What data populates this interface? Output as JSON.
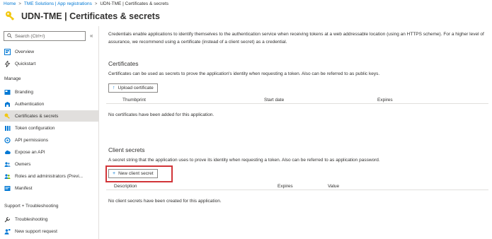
{
  "breadcrumb": {
    "items": [
      "Home",
      "TME Solutions | App registrations",
      "UDN-TME | Certificates & secrets"
    ],
    "separator": ">"
  },
  "header": {
    "title": "UDN-TME | Certificates & secrets",
    "icon": "key-icon"
  },
  "sidebar": {
    "search_placeholder": "Search (Ctrl+/)",
    "collapse_label": "«",
    "top_items": [
      {
        "label": "Overview",
        "icon": "overview-icon"
      },
      {
        "label": "Quickstart",
        "icon": "quickstart-icon"
      }
    ],
    "manage_heading": "Manage",
    "manage_items": [
      {
        "label": "Branding",
        "icon": "branding-icon"
      },
      {
        "label": "Authentication",
        "icon": "authentication-icon"
      },
      {
        "label": "Certificates & secrets",
        "icon": "key-icon",
        "active": true
      },
      {
        "label": "Token configuration",
        "icon": "token-icon"
      },
      {
        "label": "API permissions",
        "icon": "api-permissions-icon"
      },
      {
        "label": "Expose an API",
        "icon": "cloud-icon"
      },
      {
        "label": "Owners",
        "icon": "owners-icon"
      },
      {
        "label": "Roles and administrators (Previ...",
        "icon": "roles-icon"
      },
      {
        "label": "Manifest",
        "icon": "manifest-icon"
      }
    ],
    "support_heading": "Support + Troubleshooting",
    "support_items": [
      {
        "label": "Troubleshooting",
        "icon": "wrench-icon"
      },
      {
        "label": "New support request",
        "icon": "support-icon"
      }
    ]
  },
  "main": {
    "intro": "Credentials enable applications to identify themselves to the authentication service when receiving tokens at a web addressable location (using an HTTPS scheme). For a higher level of assurance, we recommend using a certificate (instead of a client secret) as a credential.",
    "certificates": {
      "title": "Certificates",
      "description": "Certificates can be used as secrets to prove the application's identity when requesting a token. Also can be referred to as public keys.",
      "button_label": "Upload certificate",
      "columns": [
        "Thumbprint",
        "Start date",
        "Expires"
      ],
      "empty_message": "No certificates have been added for this application."
    },
    "client_secrets": {
      "title": "Client secrets",
      "description": "A secret string that the application uses to prove its identity when requesting a token. Also can be referred to as application password.",
      "button_label": "New client secret",
      "columns": [
        "Description",
        "Expires",
        "Value"
      ],
      "empty_message": "No client secrets have been created for this application."
    }
  },
  "colors": {
    "link": "#0078d4",
    "highlight": "#d13438",
    "active_nav": "#e1dfdd",
    "key_icon": "#f2c811"
  }
}
